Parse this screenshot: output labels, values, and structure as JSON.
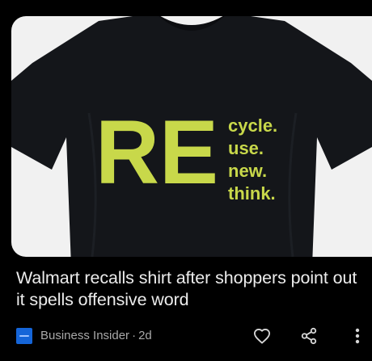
{
  "article": {
    "image": {
      "alt": "",
      "print": {
        "big_letters": "RE",
        "words": [
          "cycle.",
          "use.",
          "new.",
          "think."
        ],
        "print_color": "#c8d84a",
        "shirt_color": "#14161a",
        "background_color": "#f1f1f1"
      }
    },
    "headline": "Walmart recalls shirt after shoppers point out it spells offensive word",
    "source": {
      "name": "Business Insider",
      "separator": "·",
      "age": "2d",
      "logo_color": "#1565d8"
    },
    "actions": {
      "like_icon": "heart-icon",
      "share_icon": "share-icon",
      "more_icon": "more-vertical-icon"
    }
  },
  "theme": {
    "background": "#000000",
    "headline_color": "#ececec",
    "meta_color": "#a9a9a9"
  }
}
